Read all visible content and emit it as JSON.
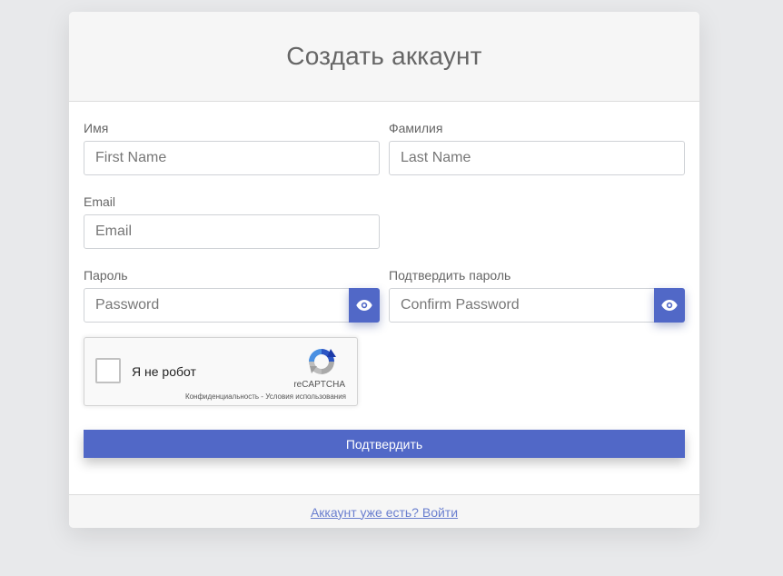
{
  "form": {
    "title": "Создать аккаунт",
    "first_name": {
      "label": "Имя",
      "placeholder": "First Name",
      "value": ""
    },
    "last_name": {
      "label": "Фамилия",
      "placeholder": "Last Name",
      "value": ""
    },
    "email": {
      "label": "Email",
      "placeholder": "Email",
      "value": ""
    },
    "password": {
      "label": "Пароль",
      "placeholder": "Password",
      "value": "",
      "toggle_icon": "eye-icon"
    },
    "confirm_password": {
      "label": "Подтвердить пароль",
      "placeholder": "Confirm Password",
      "value": "",
      "toggle_icon": "eye-icon"
    },
    "recaptcha": {
      "label": "Я не робот",
      "brand": "reCAPTCHA",
      "links": "Конфиденциальность - Условия использования",
      "checked": false
    },
    "submit_label": "Подтвердить"
  },
  "footer": {
    "login_link": "Аккаунт уже есть? Войти"
  },
  "colors": {
    "accent": "#5168c7",
    "page_background": "#e8e9eb",
    "card_header": "#f6f6f6",
    "link": "#6a7fcf"
  }
}
